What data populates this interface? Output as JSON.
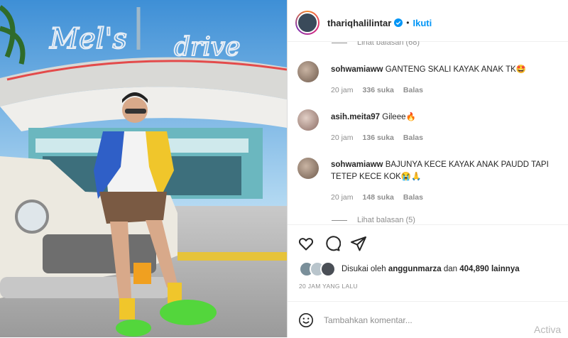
{
  "post": {
    "username": "thariqhalilintar",
    "separator": "•",
    "follow_label": "Ikuti",
    "photo_sign": "Mel's drive-in"
  },
  "comments": [
    {
      "type": "replies",
      "label": "Lihat balasan (68)"
    },
    {
      "type": "comment",
      "user": "sohwamiaww",
      "text": "GANTENG SKALI KAYAK ANAK TK🤩",
      "time": "20 jam",
      "likes": "336 suka",
      "reply": "Balas"
    },
    {
      "type": "comment",
      "user": "asih.meita97",
      "text": "Gileee🔥",
      "time": "20 jam",
      "likes": "136 suka",
      "reply": "Balas"
    },
    {
      "type": "comment",
      "user": "sohwamiaww",
      "text": "BAJUNYA KECE KAYAK ANAK PAUDD TAPI TETEP KECE KOK😭🙏",
      "time": "20 jam",
      "likes": "148 suka",
      "reply": "Balas"
    },
    {
      "type": "replies",
      "label": "Lihat balasan (5)"
    }
  ],
  "likes": {
    "prefix": "Disukai oleh",
    "user": "anggunmarza",
    "conj": "dan",
    "others": "404,890 lainnya"
  },
  "timestamp": "20 JAM YANG LALU",
  "add_comment": {
    "placeholder": "Tambahkan komentar..."
  },
  "watermark": "Activa",
  "colors": {
    "accent": "#0095f6",
    "text": "#262626",
    "muted": "#8e8e8e"
  },
  "icons": [
    "heart-icon",
    "comment-icon",
    "share-icon",
    "emoji-icon",
    "verified-icon"
  ]
}
